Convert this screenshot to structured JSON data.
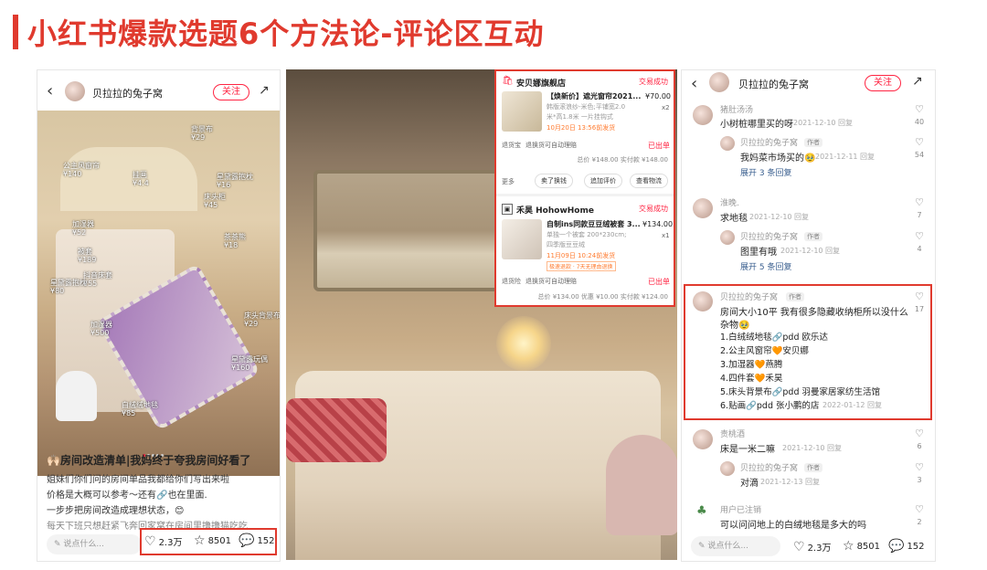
{
  "header": {
    "title": "小红书爆款选题6个方法论-评论区互动"
  },
  "post": {
    "user": "贝拉拉的兔子窝",
    "follow": "关注",
    "tags": [
      {
        "name": "背景布",
        "price": "¥29"
      },
      {
        "name": "公主风窗帘",
        "price": "¥140"
      },
      {
        "name": "挂画",
        "price": "¥4.4"
      },
      {
        "name": "星黛露抱枕",
        "price": "¥16"
      },
      {
        "name": "床头柜",
        "price": "¥45"
      },
      {
        "name": "加湿器",
        "price": "¥52"
      },
      {
        "name": "被套",
        "price": "¥189"
      },
      {
        "name": "茶茶熊",
        "price": "¥18"
      },
      {
        "name": "抖音床套",
        "price": "¥55"
      },
      {
        "name": "星黛露抱枕",
        "price": "¥80"
      },
      {
        "name": "加湿器",
        "price": "¥500"
      },
      {
        "name": "床头背景布",
        "price": "¥29"
      },
      {
        "name": "星黛露玩偶",
        "price": "¥160"
      },
      {
        "name": "白绒绒地毯",
        "price": "¥85"
      }
    ],
    "title": "🙌🏻房间改造清单|我妈终于夸我房间好看了",
    "body": [
      "姐妹们你们问的房间单品我都给你们写出来啦",
      "价格是大概可以参考～还有🔗也在里面.",
      "一步步把房间改造成理想状态，😊",
      "每天下班只想赶紧飞奔回家窝在房间里撸撸猫吃吃"
    ],
    "comment_placeholder": "说点什么...",
    "likes": "2.3万",
    "stars": "8501",
    "comments": "152"
  },
  "orders": [
    {
      "shop": "安贝娜旗舰店",
      "status": "交易成功",
      "title": "【焕新价】遮光窗帘2021...",
      "price": "¥70.00",
      "spec1": "韩版滚浪纱-米色;平铺宽2.0",
      "spec2": "米*高1.8米 一片挂钩式",
      "qty": "x2",
      "date": "10月20日 13:56前发货",
      "service": "退货宝",
      "service2": "退换货可自动理赔",
      "shipped": "已出单",
      "total": "总价 ¥148.00 实付款 ¥148.00",
      "more": "更多",
      "buttons": [
        "卖了换钱",
        "追加评价",
        "查看物流"
      ]
    },
    {
      "shop": "禾昊 HohowHome",
      "status": "交易成功",
      "title": "自制ins同款豆豆绒被套 3...",
      "price": "¥134.00",
      "spec1": "单独一个被套 200*230cm;",
      "spec2": "四季版豆豆绒",
      "qty": "x1",
      "date": "11月09日 10:24前发货",
      "badge": "极速退款 · 7天无理由退换",
      "service": "退货险",
      "service2": "退换货可自动理赔",
      "shipped": "已出单",
      "total": "总价 ¥134.00 优惠 ¥10.00 实付款 ¥124.00"
    }
  ],
  "comments_panel": {
    "user": "贝拉拉的兔子窝",
    "follow": "关注",
    "author_tag": "作者",
    "comments": [
      {
        "name": "猪肚汤汤",
        "text": "小树桩哪里买的呀",
        "time": "2021-12-10 回复",
        "likes": "40"
      },
      {
        "name": "贝拉拉的兔子窝",
        "text": "我妈菜市场买的🥹",
        "time": "2021-12-11 回复",
        "likes": "54"
      },
      {
        "expand": "展开 3 条回复"
      },
      {
        "name": "淮晚.",
        "text": "求地毯",
        "time": "2021-12-10 回复",
        "likes": "7"
      },
      {
        "name": "贝拉拉的兔子窝",
        "text": "图里有哦",
        "time": "2021-12-10 回复",
        "likes": "4"
      },
      {
        "expand": "展开 5 条回复"
      },
      {
        "name": "贝拉拉的兔子窝",
        "text": "房间大小10平 我有很多隐藏收纳柜所以没什么",
        "text2": "杂物🥹",
        "likes": "17",
        "list": [
          "1.白绒绒地毯🔗pdd 欧乐达",
          "2.公主风窗帘🧡安贝娜",
          "3.加湿器🧡燕腾",
          "4.四件套🧡禾昊",
          "5.床头背景布🔗pdd 羽曼家居家纺生活馆",
          "6.贴画🔗pdd 张小鹏的店"
        ],
        "time": "2022-01-12 回复"
      },
      {
        "name": "责桃酒",
        "text": "床是一米二嘛",
        "time": "2021-12-10 回复",
        "likes": "6"
      },
      {
        "name": "贝拉拉的兔子窝",
        "text": "对滴",
        "time": "2021-12-13 回复",
        "likes": "3"
      },
      {
        "name": "用户已注销",
        "text": "可以问问地上的白绒地毯是多大的吗",
        "likes": "2"
      }
    ],
    "comment_placeholder": "说点什么...",
    "likes": "2.3万",
    "stars": "8501",
    "comments_count": "152"
  },
  "colors": {
    "accent": "#e03a2e",
    "brand": "#ff2442"
  }
}
